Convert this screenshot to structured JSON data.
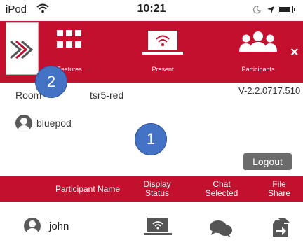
{
  "status_bar": {
    "carrier": "iPod",
    "time": "10:21"
  },
  "toolbar": {
    "items": [
      {
        "label": "Features",
        "icon": "grid-icon"
      },
      {
        "label": "Present",
        "icon": "laptop-wifi-icon"
      },
      {
        "label": "Participants",
        "icon": "participants-icon"
      }
    ],
    "close_label": "×"
  },
  "room": {
    "label": "Room",
    "name": "tsr5-red",
    "version": "V-2.2.0717.510"
  },
  "me": {
    "name": "bluepod"
  },
  "logout_label": "Logout",
  "table": {
    "headers": {
      "name": "Participant Name",
      "display_line1": "Display",
      "display_line2": "Status",
      "chat_line1": "Chat",
      "chat_line2": "Selected",
      "file_line1": "File",
      "file_line2": "Share"
    },
    "rows": [
      {
        "name": "john"
      }
    ]
  },
  "callouts": [
    "1",
    "2"
  ],
  "colors": {
    "brand_red": "#c4102f",
    "callout_blue": "#4472c4",
    "button_gray": "#6b6b6b"
  }
}
